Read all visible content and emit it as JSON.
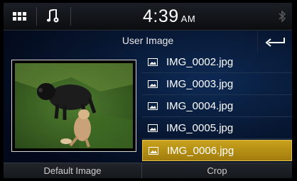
{
  "statusbar": {
    "time": "4:39",
    "ampm": "AM",
    "menu_icon": "grid-menu-icon",
    "music_icon": "music-settings-icon",
    "bluetooth_icon": "bluetooth-icon"
  },
  "title": "User Image",
  "back_icon": "return-arrow-icon",
  "files": [
    {
      "name": "IMG_0002.jpg"
    },
    {
      "name": "IMG_0003.jpg"
    },
    {
      "name": "IMG_0004.jpg"
    },
    {
      "name": "IMG_0005.jpg"
    },
    {
      "name": "IMG_0006.jpg"
    }
  ],
  "selected_file": "IMG_0006.jpg",
  "bottom": {
    "default_label": "Default Image",
    "crop_label": "Crop"
  },
  "colors": {
    "accent": "#c9a21e",
    "background": "#071630"
  }
}
